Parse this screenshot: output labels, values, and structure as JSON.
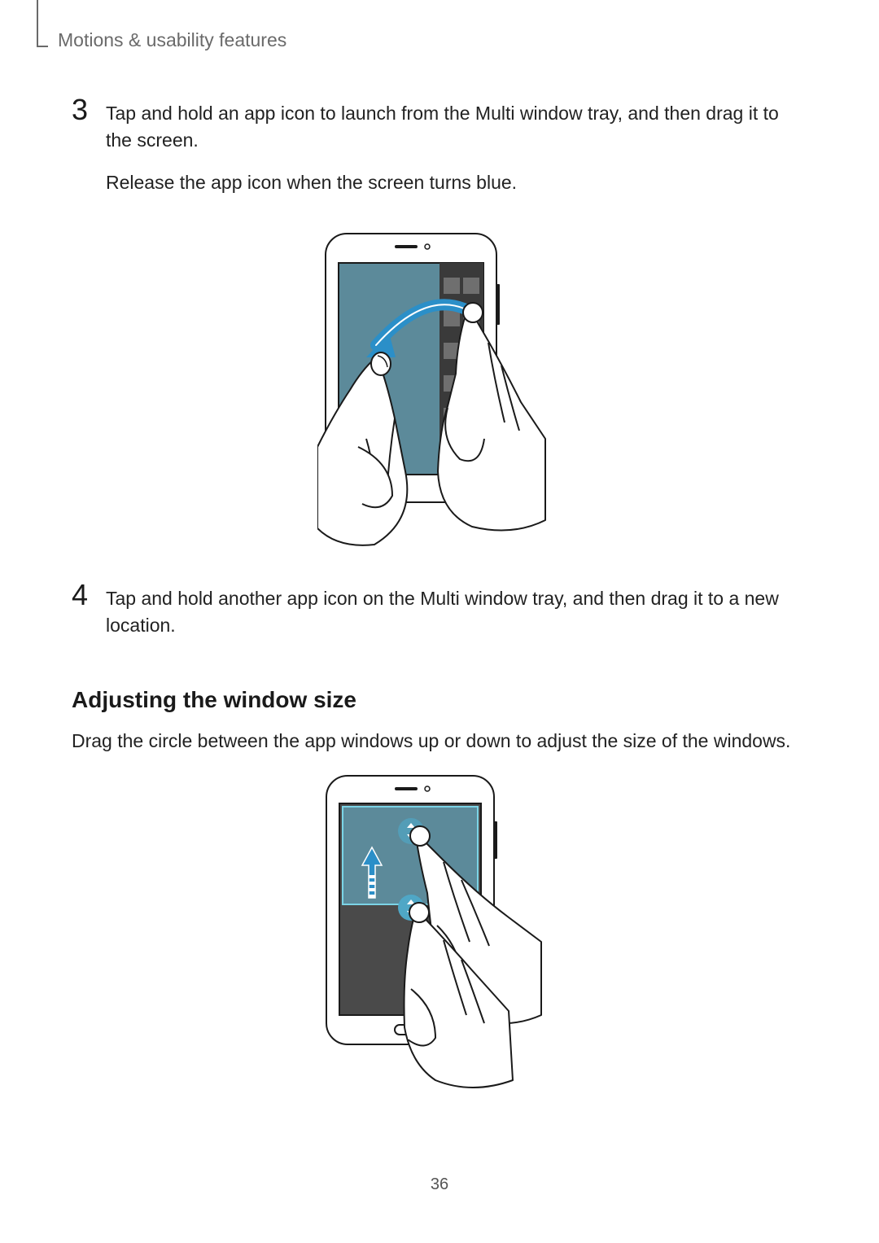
{
  "header": {
    "title": "Motions & usability features"
  },
  "steps": {
    "s3": {
      "num": "3",
      "p1": "Tap and hold an app icon to launch from the Multi window tray, and then drag it to the screen.",
      "p2": "Release the app icon when the screen turns blue."
    },
    "s4": {
      "num": "4",
      "p1": "Tap and hold another app icon on the Multi window tray, and then drag it to a new location."
    }
  },
  "section": {
    "h2": "Adjusting the window size",
    "p": "Drag the circle between the app windows up or down to adjust the size of the windows."
  },
  "page_number": "36"
}
